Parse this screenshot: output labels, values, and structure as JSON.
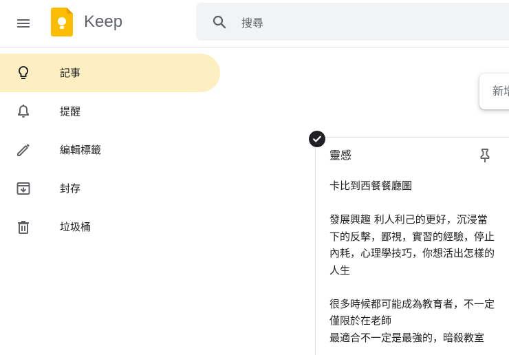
{
  "header": {
    "app_name": "Keep",
    "search_placeholder": "搜尋",
    "icons": {
      "menu": "hamburger-menu-icon",
      "logo": "keep-logo-icon",
      "search": "search-icon"
    },
    "colors": {
      "logo": "#fbbc04",
      "search_bg": "#f1f3f4"
    }
  },
  "sidebar": {
    "active_color": "#feefc3",
    "items": [
      {
        "label": "記事",
        "icon": "lightbulb-icon",
        "active": true
      },
      {
        "label": "提醒",
        "icon": "bell-icon",
        "active": false
      },
      {
        "label": "編輯標籤",
        "icon": "pencil-icon",
        "active": false
      },
      {
        "label": "封存",
        "icon": "archive-icon",
        "active": false
      },
      {
        "label": "垃圾桶",
        "icon": "trash-icon",
        "active": false
      }
    ]
  },
  "main": {
    "take_note_text": "新增記事...",
    "note": {
      "selected": true,
      "title": "靈感",
      "paragraphs": [
        "卡比到西餐餐廳圖",
        "發展興趣 利人利己的更好，沉浸當下的反擊，鄙視，實習的經驗，停止內耗，心理學技巧，你想活出怎樣的人生",
        "很多時候都可能成為教育者，不一定僅限於在老師\n最適合不一定是最強的，暗殺教室"
      ]
    }
  }
}
